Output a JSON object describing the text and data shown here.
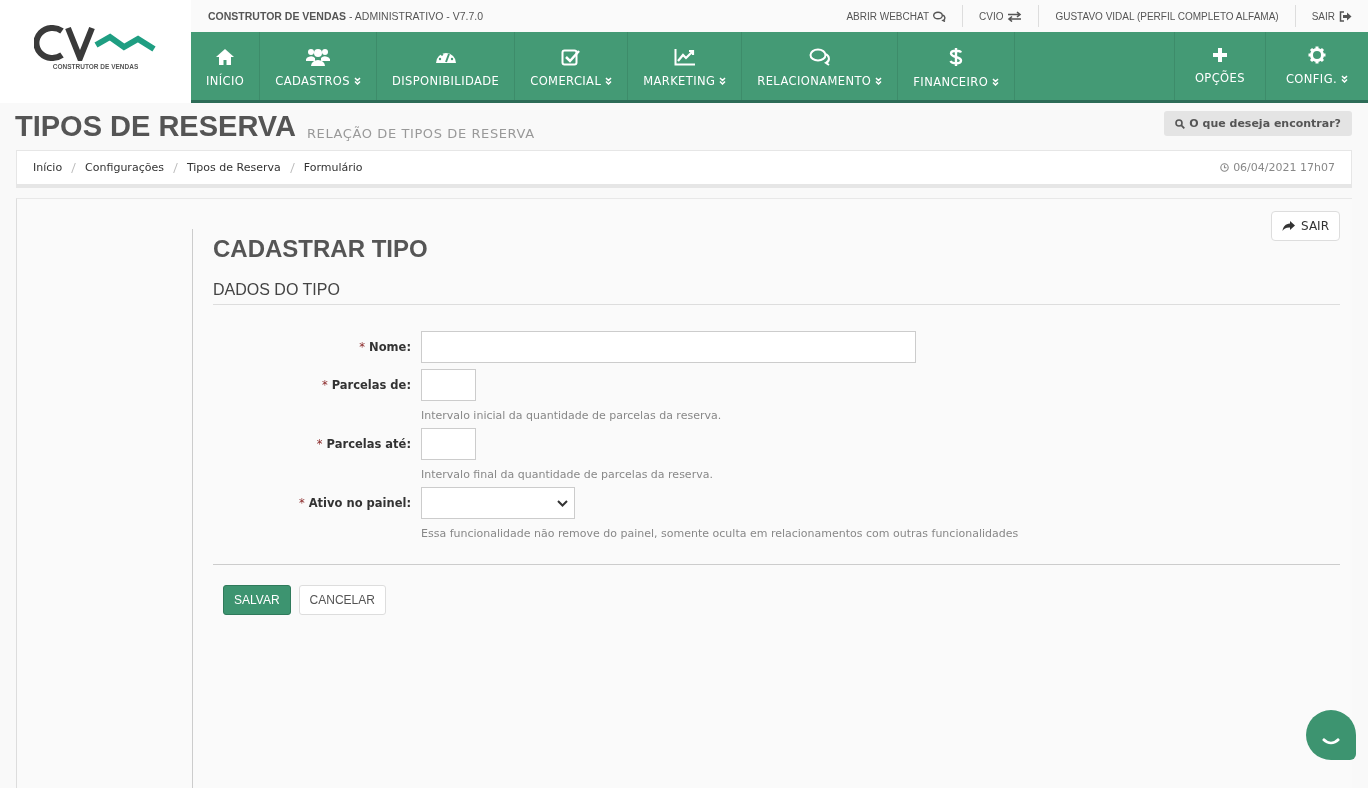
{
  "header": {
    "logo_text": "CONSTRUTOR DE VENDAS",
    "app_name": "CONSTRUTOR DE VENDAS",
    "app_suffix": " - ADMINISTRATIVO - V7.7.0",
    "top_links": [
      "ABRIR WEBCHAT",
      "CVIO",
      "GUSTAVO VIDAL (PERFIL COMPLETO ALFAMA)",
      "SAIR"
    ]
  },
  "nav": [
    {
      "label": "INÍCIO",
      "has_menu": false
    },
    {
      "label": "CADASTROS",
      "has_menu": true
    },
    {
      "label": "DISPONIBILIDADE",
      "has_menu": false
    },
    {
      "label": "COMERCIAL",
      "has_menu": true
    },
    {
      "label": "MARKETING",
      "has_menu": true
    },
    {
      "label": "RELACIONAMENTO",
      "has_menu": true
    },
    {
      "label": "FINANCEIRO",
      "has_menu": true
    }
  ],
  "nav_right": [
    {
      "label": "OPÇÕES",
      "has_menu": false
    },
    {
      "label": "CONFIG.",
      "has_menu": true
    }
  ],
  "page": {
    "title": "TIPOS DE RESERVA",
    "subtitle": "RELAÇÃO DE TIPOS DE RESERVA",
    "search_button": "O que deseja encontrar?"
  },
  "breadcrumb": [
    "Início",
    "Configurações",
    "Tipos de Reserva",
    "Formulário"
  ],
  "timestamp": "06/04/2021 17h07",
  "exit_button": "SAIR",
  "form": {
    "title": "CADASTRAR TIPO",
    "section": "DADOS DO TIPO",
    "fields": [
      {
        "label": "Nome:",
        "kind": "text"
      },
      {
        "label": "Parcelas de:",
        "kind": "text",
        "help": "Intervalo inicial da quantidade de parcelas da reserva."
      },
      {
        "label": "Parcelas até:",
        "kind": "text",
        "help": "Intervalo final da quantidade de parcelas da reserva."
      },
      {
        "label": "Ativo no painel:",
        "kind": "select",
        "help": "Essa funcionalidade não remove do painel, somente oculta em relacionamentos com outras funcionalidades"
      }
    ],
    "required_mark": "*",
    "buttons": [
      {
        "label": "SALVAR",
        "kind": "primary"
      },
      {
        "label": "CANCELAR",
        "kind": "default"
      }
    ]
  }
}
